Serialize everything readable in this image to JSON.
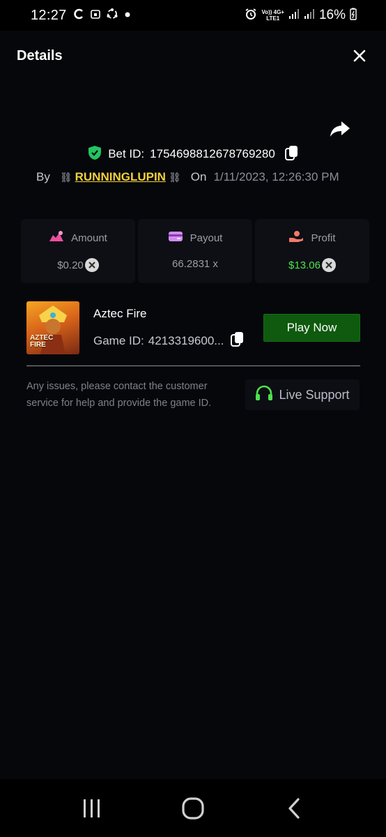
{
  "status_bar": {
    "time": "12:27",
    "network_top": "Vo)) 4G+",
    "network_bottom": "LTE1",
    "battery": "16%"
  },
  "header": {
    "title": "Details"
  },
  "bet": {
    "label": "Bet ID:",
    "id": "1754698812678769280",
    "by_label": "By",
    "username": "RUNNINGLUPIN",
    "chain_left": "⛓",
    "chain_right": "⛓",
    "on_label": "On",
    "date": "1/11/2023, 12:26:30 PM"
  },
  "stats": {
    "amount": {
      "label": "Amount",
      "value": "$0.20"
    },
    "payout": {
      "label": "Payout",
      "value": "66.2831 x"
    },
    "profit": {
      "label": "Profit",
      "value": "$13.06"
    }
  },
  "game": {
    "name": "Aztec Fire",
    "id_label": "Game ID:",
    "id_value": "4213319600...",
    "thumb_text_1": "AZTEC",
    "thumb_text_2": "FIRE",
    "play_label": "Play Now"
  },
  "support": {
    "help_text": "Any issues, please contact the customer service for help and provide the game ID.",
    "button_label": "Live Support"
  },
  "colors": {
    "accent_green": "#0f5a0f",
    "profit_green": "#4ee04e",
    "username_yellow": "#f2d13b"
  }
}
